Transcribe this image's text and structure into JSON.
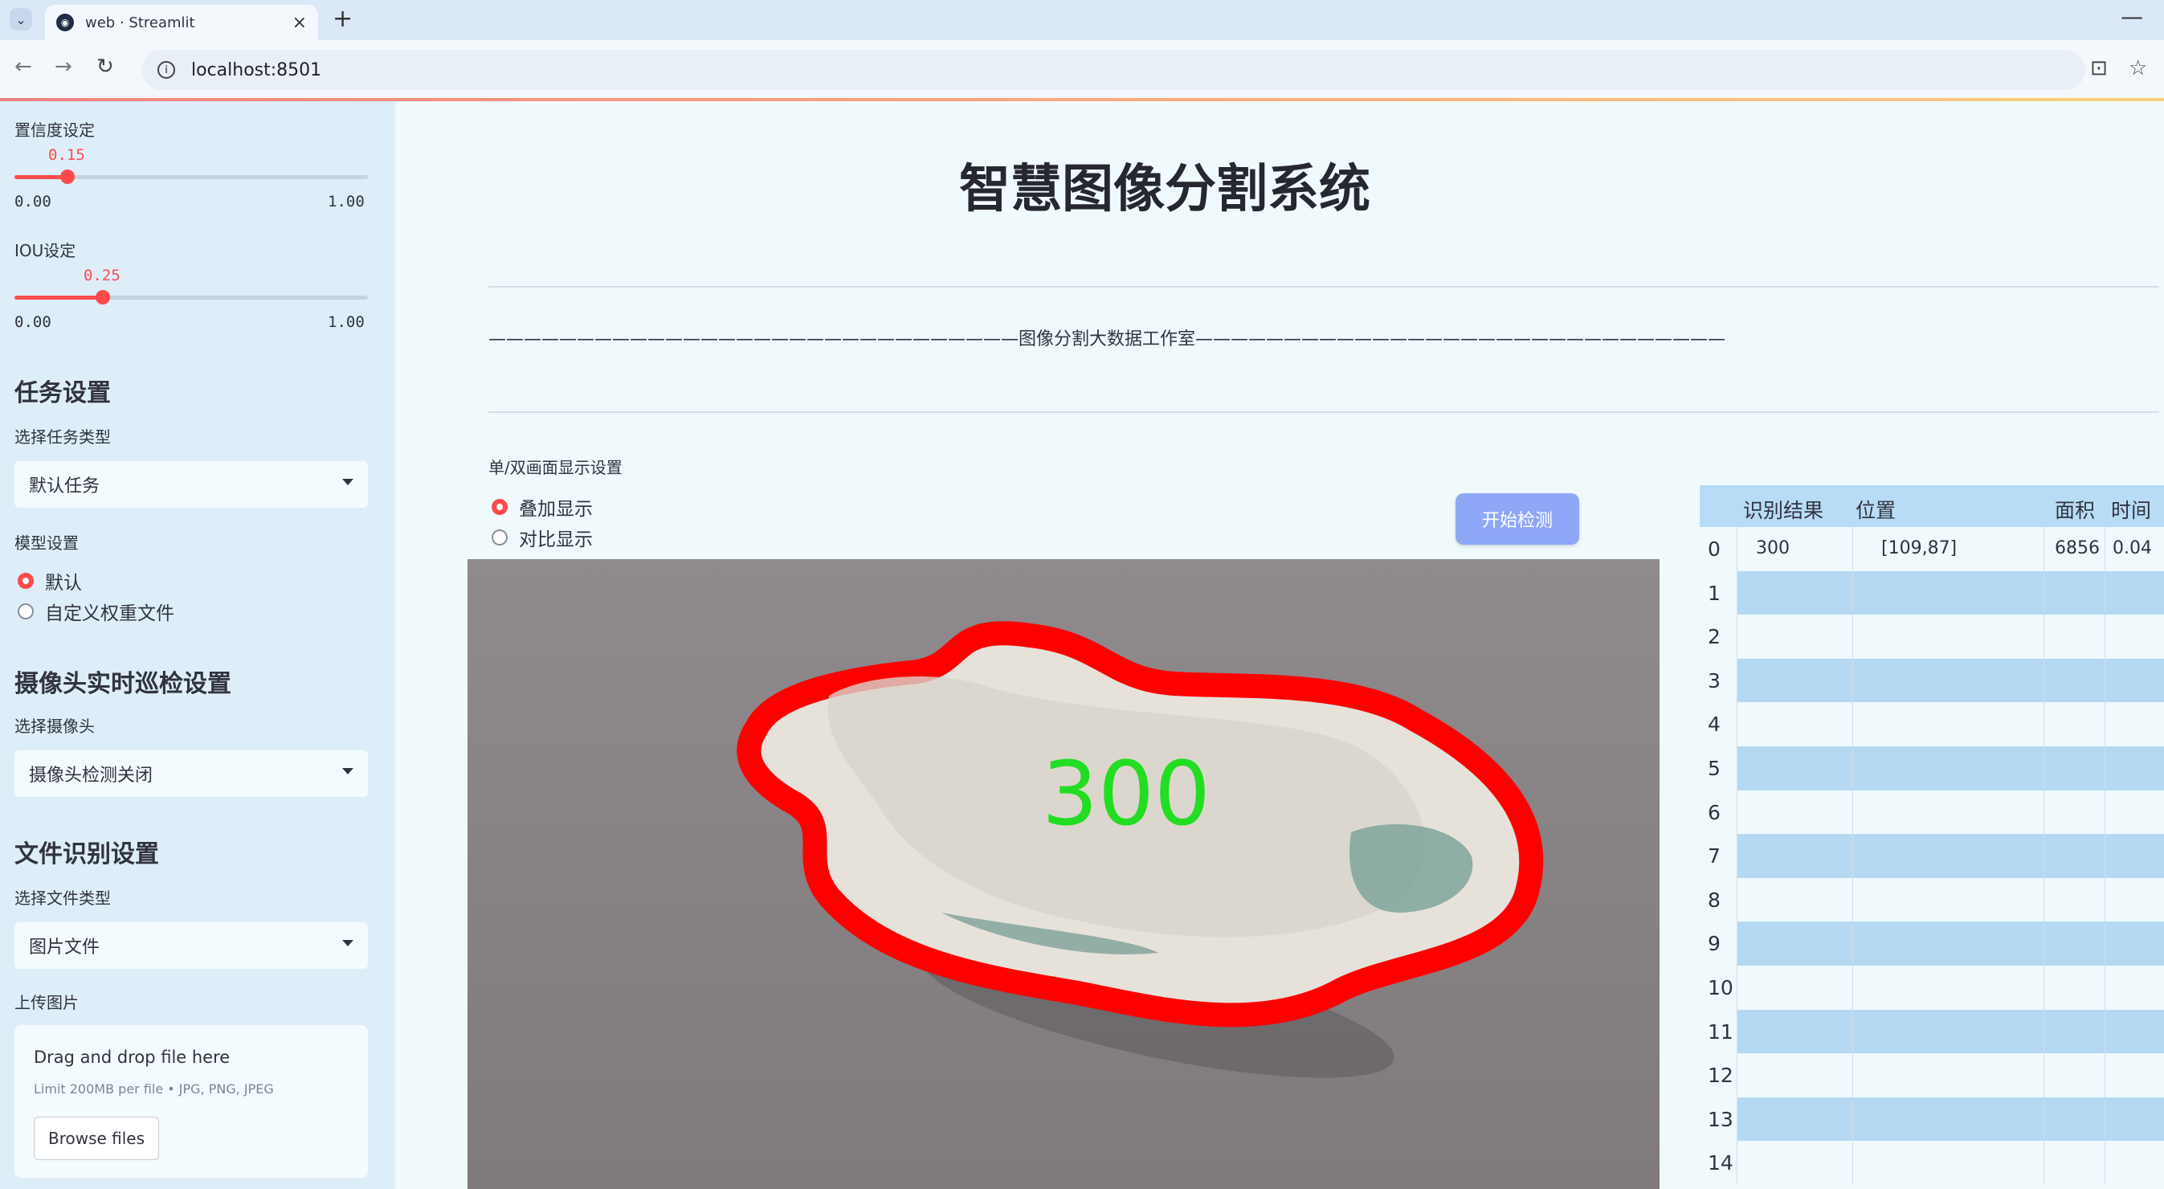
{
  "browser": {
    "tab_title": "web · Streamlit",
    "url": "localhost:8501"
  },
  "sidebar": {
    "confidence": {
      "label": "置信度设定",
      "value": "0.15",
      "value_num": 0.15,
      "min": "0.00",
      "max": "1.00"
    },
    "iou": {
      "label": "IOU设定",
      "value": "0.25",
      "value_num": 0.25,
      "min": "0.00",
      "max": "1.00"
    },
    "task_header": "任务设置",
    "task_type_label": "选择任务类型",
    "task_type_value": "默认任务",
    "model_label": "模型设置",
    "model_options": [
      "默认",
      "自定义权重文件"
    ],
    "camera_header": "摄像头实时巡检设置",
    "camera_label": "选择摄像头",
    "camera_value": "摄像头检测关闭",
    "file_header": "文件识别设置",
    "file_type_label": "选择文件类型",
    "file_type_value": "图片文件",
    "upload_label": "上传图片",
    "upload_drag": "Drag and drop file here",
    "upload_limit": "Limit 200MB per file • JPG, PNG, JPEG",
    "browse_label": "Browse files"
  },
  "main": {
    "title": "智慧图像分割系统",
    "banner": "——————————————————————————————图像分割大数据工作室——————————————————————————————",
    "display_label": "单/双画面显示设置",
    "display_options": [
      "叠加显示",
      "对比显示"
    ],
    "start_button": "开始检测",
    "overlay_text": "300"
  },
  "table": {
    "headers": [
      "识别结果",
      "位置",
      "面积",
      "时间"
    ],
    "rows": [
      {
        "index": "0",
        "result": "300",
        "position": "[109,87]",
        "area": "6856",
        "time": "0.04"
      },
      {
        "index": "1"
      },
      {
        "index": "2"
      },
      {
        "index": "3"
      },
      {
        "index": "4"
      },
      {
        "index": "5"
      },
      {
        "index": "6"
      },
      {
        "index": "7"
      },
      {
        "index": "8"
      },
      {
        "index": "9"
      },
      {
        "index": "10"
      },
      {
        "index": "11"
      },
      {
        "index": "12"
      },
      {
        "index": "13"
      },
      {
        "index": "14"
      }
    ]
  },
  "colors": {
    "accent": "#ff4b4b",
    "sidebar_bg": "#ddeef9",
    "button": "#8ea7f7",
    "overlay_text": "#22dd22",
    "mask_outline": "#ff0000"
  }
}
